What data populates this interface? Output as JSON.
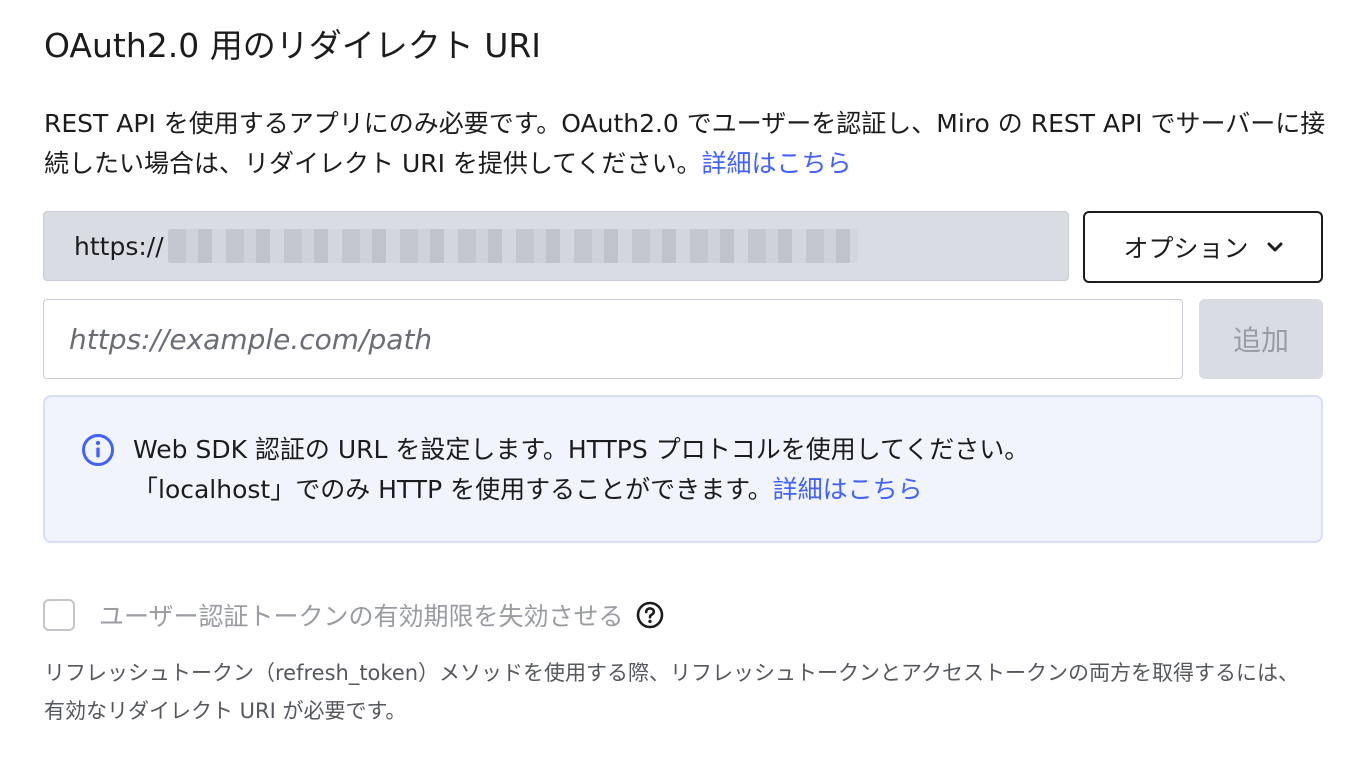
{
  "section": {
    "title": "OAuth2.0 用のリダイレクト URI",
    "description": "REST API を使用するアプリにのみ必要です。OAuth2.0 でユーザーを認証し、Miro の REST API でサーバーに接続したい場合は、リダイレクト URI を提供してください。",
    "description_link": "詳細はこちら"
  },
  "existing_uri": {
    "prefix": "https://"
  },
  "options_button": {
    "label": "オプション",
    "icon": "chevron-down-icon"
  },
  "new_uri": {
    "value": "",
    "placeholder": "https://example.com/path"
  },
  "add_button": {
    "label": "追加"
  },
  "info": {
    "icon": "info-icon",
    "line1": "Web SDK 認証の URL を設定します。HTTPS プロトコルを使用してください。",
    "line2": "「localhost」でのみ HTTP を使用することができます。",
    "link": "詳細はこちら"
  },
  "expire_option": {
    "checked": false,
    "label": "ユーザー認証トークンの有効期限を失効させる",
    "help_icon": "question-circle-icon",
    "note": "リフレッシュトークン（refresh_token）メソッドを使用する際、リフレッシュトークンとアクセストークンの両方を取得するには、有効なリダイレクト URI が必要です。"
  },
  "colors": {
    "link": "#4262ff",
    "info_bg": "#f1f4fd",
    "disabled_bg": "#d9dce3",
    "text": "#1c1c1e",
    "muted": "#9a9ca3"
  }
}
